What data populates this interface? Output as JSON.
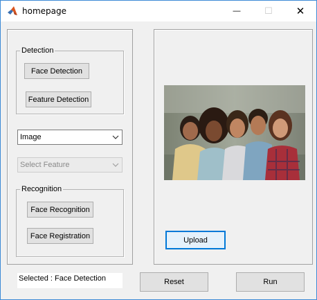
{
  "window": {
    "title": "homepage",
    "minimize_glyph": "—",
    "maximize_glyph": "☐",
    "close_glyph": "✕"
  },
  "detection": {
    "label": "Detection",
    "face_detection": "Face Detection",
    "feature_detection": "Feature Detection"
  },
  "source_select": {
    "value": "Image"
  },
  "feature_select": {
    "value": "Select Feature"
  },
  "recognition": {
    "label": "Recognition",
    "face_recognition": "Face Recognition",
    "face_registration": "Face Registration"
  },
  "status": {
    "text": "Selected : Face Detection"
  },
  "right_panel": {
    "upload": "Upload"
  },
  "actions": {
    "reset": "Reset",
    "run": "Run"
  },
  "colors": {
    "window_border": "#3c8ad6",
    "focus_accent": "#0078d7",
    "panel_bg": "#f0f0f0"
  }
}
